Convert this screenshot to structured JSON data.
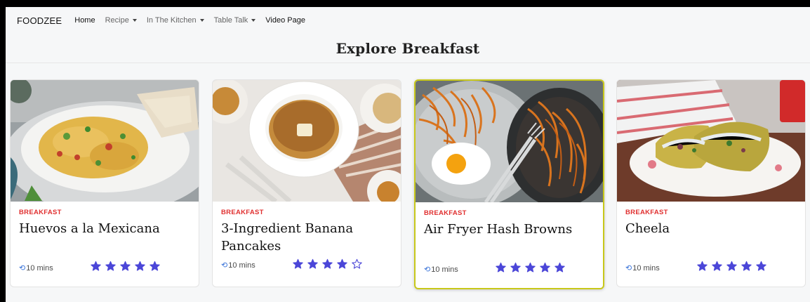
{
  "nav": {
    "brand": "FOODZEE",
    "items": [
      {
        "label": "Home"
      },
      {
        "label": "Recipe"
      },
      {
        "label": "In The Kitchen"
      },
      {
        "label": "Table Talk"
      },
      {
        "label": "Video Page"
      }
    ]
  },
  "page": {
    "title": "Explore Breakfast"
  },
  "cards": [
    {
      "category": "BREAKFAST",
      "title": "Huevos a la Mexicana",
      "time": "10 mins",
      "rating": 5,
      "rating_max": 5
    },
    {
      "category": "BREAKFAST",
      "title": "3-Ingredient Banana Pancakes",
      "time": "10 mins",
      "rating": 4,
      "rating_max": 5
    },
    {
      "category": "BREAKFAST",
      "title": "Air Fryer Hash Browns",
      "time": "10 mins",
      "rating": 5,
      "rating_max": 5
    },
    {
      "category": "BREAKFAST",
      "title": "Cheela",
      "time": "10 mins",
      "rating": 5,
      "rating_max": 5
    }
  ],
  "colors": {
    "category": "#e02f2f",
    "star": "#4b46d8",
    "clock": "#3a74d9",
    "highlight_border": "#c8c81a"
  },
  "icons": {
    "clock": "clock-icon",
    "star_filled": "star-filled-icon",
    "star_empty": "star-outline-icon",
    "caret": "caret-down-icon"
  }
}
